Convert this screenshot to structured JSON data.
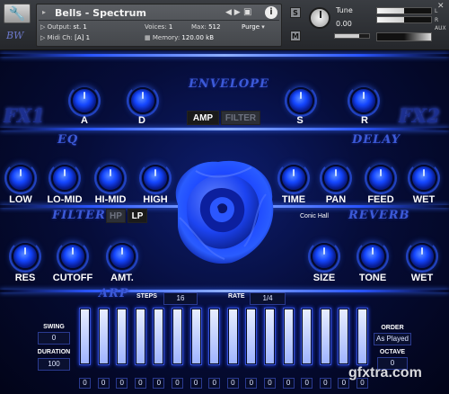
{
  "header": {
    "instrument_name": "Bells - Spectrum",
    "logo_text": "BW",
    "output_label": "Output:",
    "output_value": "st. 1",
    "voices_label": "Voices:",
    "voices_value": "1",
    "max_label": "Max:",
    "max_value": "512",
    "purge_label": "Purge",
    "midi_label": "Midi Ch:",
    "midi_value": "[A] 1",
    "memory_label": "Memory:",
    "memory_value": "120.00 kB",
    "s_label": "S",
    "m_label": "M",
    "tune_label": "Tune",
    "tune_value": "0.00",
    "aux_label": "AUX",
    "meter_l": "L",
    "meter_r": "R",
    "meter_l_level": 0.5,
    "meter_r_level": 0.5,
    "volume_level": 0.7
  },
  "envelope": {
    "title": "ENVELOPE",
    "knobs": [
      "A",
      "D",
      "S",
      "R"
    ],
    "amp_label": "AMP",
    "filter_label": "FILTER"
  },
  "fx_left": "FX1",
  "fx_right": "FX2",
  "eq": {
    "title": "EQ",
    "knobs": [
      "LOW",
      "LO-MID",
      "HI-MID",
      "HIGH"
    ]
  },
  "delay": {
    "title": "DELAY",
    "knobs": [
      "TIME",
      "PAN",
      "FEED",
      "WET"
    ]
  },
  "filter": {
    "title": "FILTER",
    "hp_label": "HP",
    "lp_label": "LP",
    "knobs": [
      "RES",
      "CUTOFF",
      "AMT."
    ]
  },
  "reverb": {
    "title": "REVERB",
    "preset": "Conic Hall",
    "knobs": [
      "SIZE",
      "TONE",
      "WET"
    ]
  },
  "arp": {
    "title": "ARP",
    "steps_label": "STEPS",
    "steps_value": "16",
    "rate_label": "RATE",
    "rate_value": "1/4",
    "swing_label": "SWING",
    "swing_value": "0",
    "duration_label": "DURATION",
    "duration_value": "100",
    "order_label": "ORDER",
    "order_value": "As Played",
    "octave_label": "OCTAVE",
    "octave_value": "0",
    "bar_levels": [
      1,
      1,
      1,
      1,
      1,
      1,
      1,
      1,
      1,
      1,
      1,
      1,
      1,
      1,
      1,
      1
    ],
    "step_values": [
      "0",
      "0",
      "0",
      "0",
      "0",
      "0",
      "0",
      "0",
      "0",
      "0",
      "0",
      "0",
      "0",
      "0",
      "0",
      "0"
    ]
  },
  "watermark": "gfxtra.com",
  "colors": {
    "accent": "#1446ff",
    "title": "#3c5ad8",
    "background": "#060d3a"
  }
}
